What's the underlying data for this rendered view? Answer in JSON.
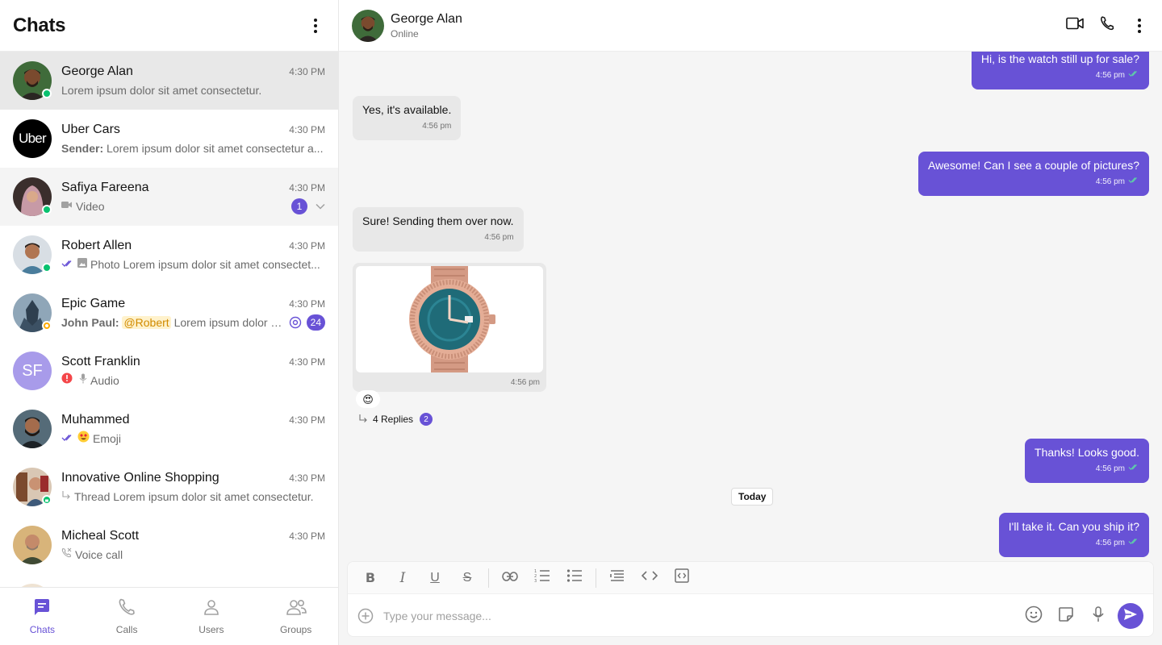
{
  "sidebar": {
    "title": "Chats",
    "chats": [
      {
        "name": "George Alan",
        "time": "4:30 PM",
        "preview": "Lorem ipsum dolor sit amet consectetur."
      },
      {
        "name": "Uber Cars",
        "time": "4:30 PM",
        "sender": "Sender:",
        "preview": "Lorem ipsum dolor sit amet consectetur a...",
        "logo_text": "Uber"
      },
      {
        "name": "Safiya Fareena",
        "time": "4:30 PM",
        "preview": "Video",
        "unread": "1"
      },
      {
        "name": "Robert Allen",
        "time": "4:30 PM",
        "preview": "Photo Lorem ipsum dolor sit amet consectet..."
      },
      {
        "name": "Epic Game",
        "time": "4:30 PM",
        "sender": "John Paul:",
        "mention": "@Robert",
        "preview": "Lorem ipsum dolor s...",
        "unread": "24"
      },
      {
        "name": "Scott Franklin",
        "time": "4:30 PM",
        "initials": "SF",
        "preview": "Audio"
      },
      {
        "name": "Muhammed",
        "time": "4:30 PM",
        "preview": "Emoji"
      },
      {
        "name": "Innovative Online Shopping",
        "time": "4:30 PM",
        "preview": "Thread Lorem ipsum dolor sit amet consectetur."
      },
      {
        "name": "Micheal Scott",
        "time": "4:30 PM",
        "preview": "Voice call"
      }
    ],
    "nav": [
      {
        "label": "Chats",
        "icon": "chat-icon"
      },
      {
        "label": "Calls",
        "icon": "phone-icon"
      },
      {
        "label": "Users",
        "icon": "user-icon"
      },
      {
        "label": "Groups",
        "icon": "group-icon"
      }
    ]
  },
  "header": {
    "name": "George Alan",
    "status": "Online"
  },
  "messages": [
    {
      "dir": "out",
      "text": "Hi, is the watch still up for sale?",
      "time": "4:56 pm"
    },
    {
      "dir": "in",
      "text": "Yes, it's available.",
      "time": "4:56 pm"
    },
    {
      "dir": "out",
      "text": "Awesome! Can I see a couple of pictures?",
      "time": "4:56 pm"
    },
    {
      "dir": "in",
      "text": "Sure! Sending them over now.",
      "time": "4:56 pm"
    },
    {
      "dir": "in",
      "type": "image",
      "image": "watch-photo",
      "time": "4:56 pm",
      "reaction": "😍",
      "replies": "4 Replies",
      "replies_count": "2"
    },
    {
      "dir": "out",
      "text": "Thanks! Looks good.",
      "time": "4:56 pm"
    },
    {
      "dir": "out",
      "text": "I'll take it. Can you ship it?",
      "time": "4:56 pm"
    }
  ],
  "date_separator": "Today",
  "composer": {
    "placeholder": "Type your message..."
  },
  "colors": {
    "accent": "#6852d6",
    "online": "#09c26f",
    "error": "#f44649",
    "warning": "#ffab00"
  }
}
